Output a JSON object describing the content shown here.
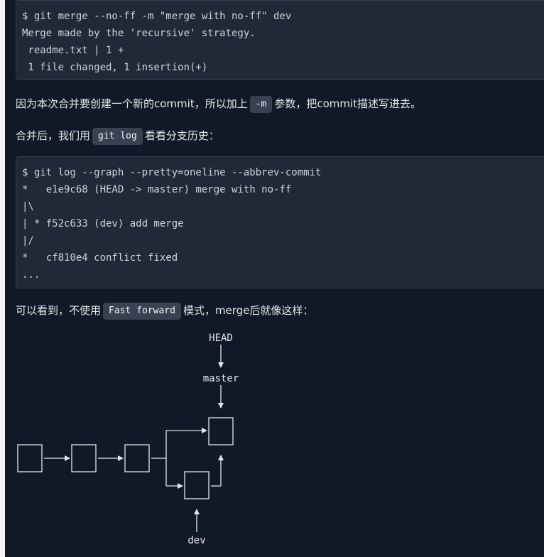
{
  "code1": {
    "lines": [
      "$ git merge --no-ff -m \"merge with no-ff\" dev",
      "Merge made by the 'recursive' strategy.",
      " readme.txt | 1 +",
      " 1 file changed, 1 insertion(+)"
    ]
  },
  "para1": {
    "before": "因为本次合并要创建一个新的commit，所以加上",
    "code": "-m",
    "after": "参数，把commit描述写进去。"
  },
  "para2": {
    "before": "合并后，我们用",
    "code": "git log",
    "after": "看看分支历史："
  },
  "code2": {
    "lines": [
      "$ git log --graph --pretty=oneline --abbrev-commit",
      "*   e1e9c68 (HEAD -> master) merge with no-ff",
      "|\\",
      "| * f52c633 (dev) add merge",
      "|/",
      "*   cf810e4 conflict fixed",
      "..."
    ]
  },
  "para3": {
    "before": "可以看到，不使用",
    "code": "Fast forward",
    "after": "模式，merge后就像这样："
  },
  "diagram": {
    "head_label": "HEAD",
    "master_label": "master",
    "dev_label": "dev"
  }
}
